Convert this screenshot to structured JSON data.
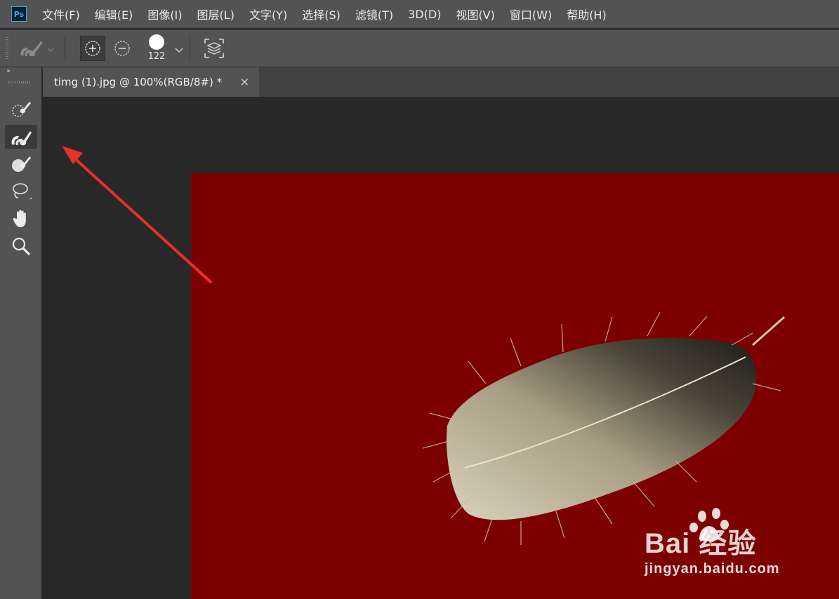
{
  "app": {
    "logo_text": "Ps"
  },
  "menu": [
    "文件(F)",
    "编辑(E)",
    "图像(I)",
    "图层(L)",
    "文字(Y)",
    "选择(S)",
    "滤镜(T)",
    "3D(D)",
    "视图(V)",
    "窗口(W)",
    "帮助(H)"
  ],
  "options": {
    "brush_size": "122",
    "tool_preset_icon": "quick-selection-preset-icon",
    "add_icon": "add-to-selection-icon",
    "subtract_icon": "subtract-from-selection-icon",
    "auto_enhance_icon": "select-all-layers-icon"
  },
  "tools": [
    {
      "name": "quick-selection-tool"
    },
    {
      "name": "refine-brush-tool",
      "active": true
    },
    {
      "name": "brush-tool"
    },
    {
      "name": "lasso-tool"
    },
    {
      "name": "hand-tool"
    },
    {
      "name": "zoom-tool"
    }
  ],
  "document": {
    "tab_title": "timg (1).jpg @ 100%(RGB/8#) *",
    "close_glyph": "×",
    "image_background": "#7d0000"
  },
  "watermark": {
    "brand": "Bai  经验",
    "url": "jingyan.baidu.com"
  },
  "colors": {
    "ui_panel": "#535353",
    "canvas_bg": "#282828",
    "arrow": "#e8302a"
  }
}
